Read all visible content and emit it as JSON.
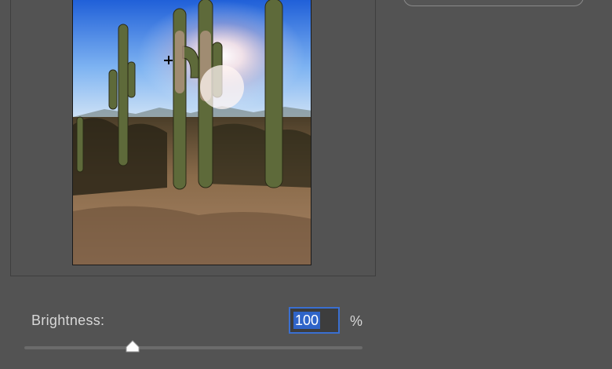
{
  "dialog": {
    "preview_image_alt": "Desert saguaro cacti against a sunlit sky"
  },
  "controls": {
    "brightness_label": "Brightness:",
    "brightness_value": "100",
    "brightness_unit": "%",
    "brightness_slider_fraction": 0.32
  },
  "colors": {
    "background": "#535353",
    "input_focus": "#3a6fd0",
    "selection": "#2f64c8"
  }
}
